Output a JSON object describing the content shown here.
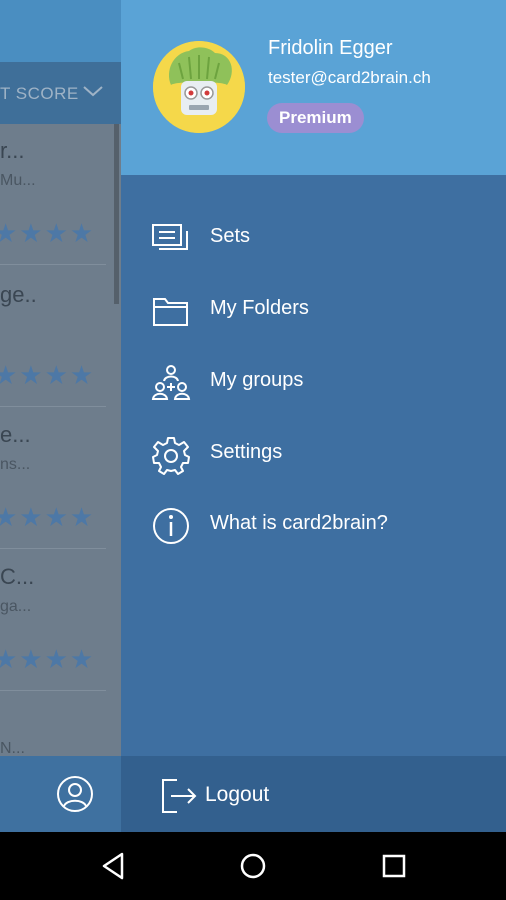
{
  "background": {
    "sort_label": "T SCORE",
    "rows": [
      {
        "title": "r...",
        "subtitle": "Mu...",
        "stars": "★★★★"
      },
      {
        "title": "ge..",
        "subtitle": "",
        "stars": "★★★★"
      },
      {
        "title": "e...",
        "subtitle": "ns...",
        "stars": "★★★★"
      },
      {
        "title": "C...",
        "subtitle": "ga...",
        "stars": "★★★★"
      },
      {
        "title": "",
        "subtitle": "N...",
        "stars": ""
      }
    ]
  },
  "drawer": {
    "user": {
      "name": "Fridolin Egger",
      "email": "tester@card2brain.ch",
      "badge": "Premium"
    },
    "menu": [
      {
        "label": "Sets",
        "icon": "cards-icon"
      },
      {
        "label": "My Folders",
        "icon": "folder-icon"
      },
      {
        "label": "My groups",
        "icon": "group-icon"
      },
      {
        "label": "Settings",
        "icon": "gear-icon"
      },
      {
        "label": "What is card2brain?",
        "icon": "info-icon"
      }
    ],
    "footer": {
      "logout_label": "Logout"
    }
  },
  "colors": {
    "header": "#5aa3d6",
    "drawer": "#3e6fa1",
    "footer": "#33608e",
    "badge": "#9b8ed2"
  }
}
